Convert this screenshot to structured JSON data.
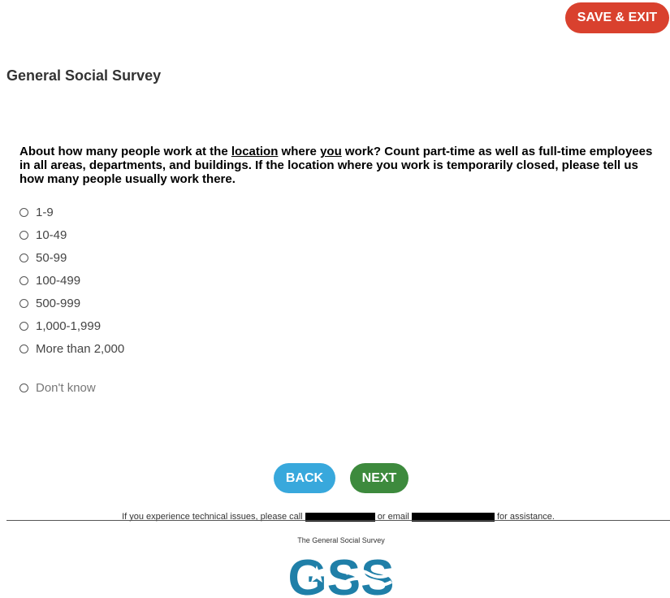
{
  "header": {
    "save_exit_label": "SAVE & EXIT"
  },
  "survey": {
    "title": "General Social Survey"
  },
  "question": {
    "part1": "About how many people work at the ",
    "underline1": "location",
    "part2": " where ",
    "underline2": "you",
    "part3": " work? Count part-time as well as full-time employees in all areas, departments, and buildings. If the location where you work is temporarily closed, please tell us how many people usually work there."
  },
  "options": [
    {
      "label": "1-9"
    },
    {
      "label": "10-49"
    },
    {
      "label": "50-99"
    },
    {
      "label": "100-499"
    },
    {
      "label": "500-999"
    },
    {
      "label": "1,000-1,999"
    },
    {
      "label": "More than 2,000"
    }
  ],
  "dont_know": {
    "label": "Don't know"
  },
  "nav": {
    "back_label": "BACK",
    "next_label": "NEXT"
  },
  "footer": {
    "text_before": "If you experience technical issues, please call ",
    "text_middle": " or email ",
    "text_after": " for assistance."
  },
  "branding": {
    "caption": "The General Social Survey",
    "logo_text": "GSS"
  },
  "colors": {
    "save_exit": "#d9412e",
    "back": "#38a8dc",
    "next": "#3d8a3d",
    "logo": "#1f7fa8"
  }
}
